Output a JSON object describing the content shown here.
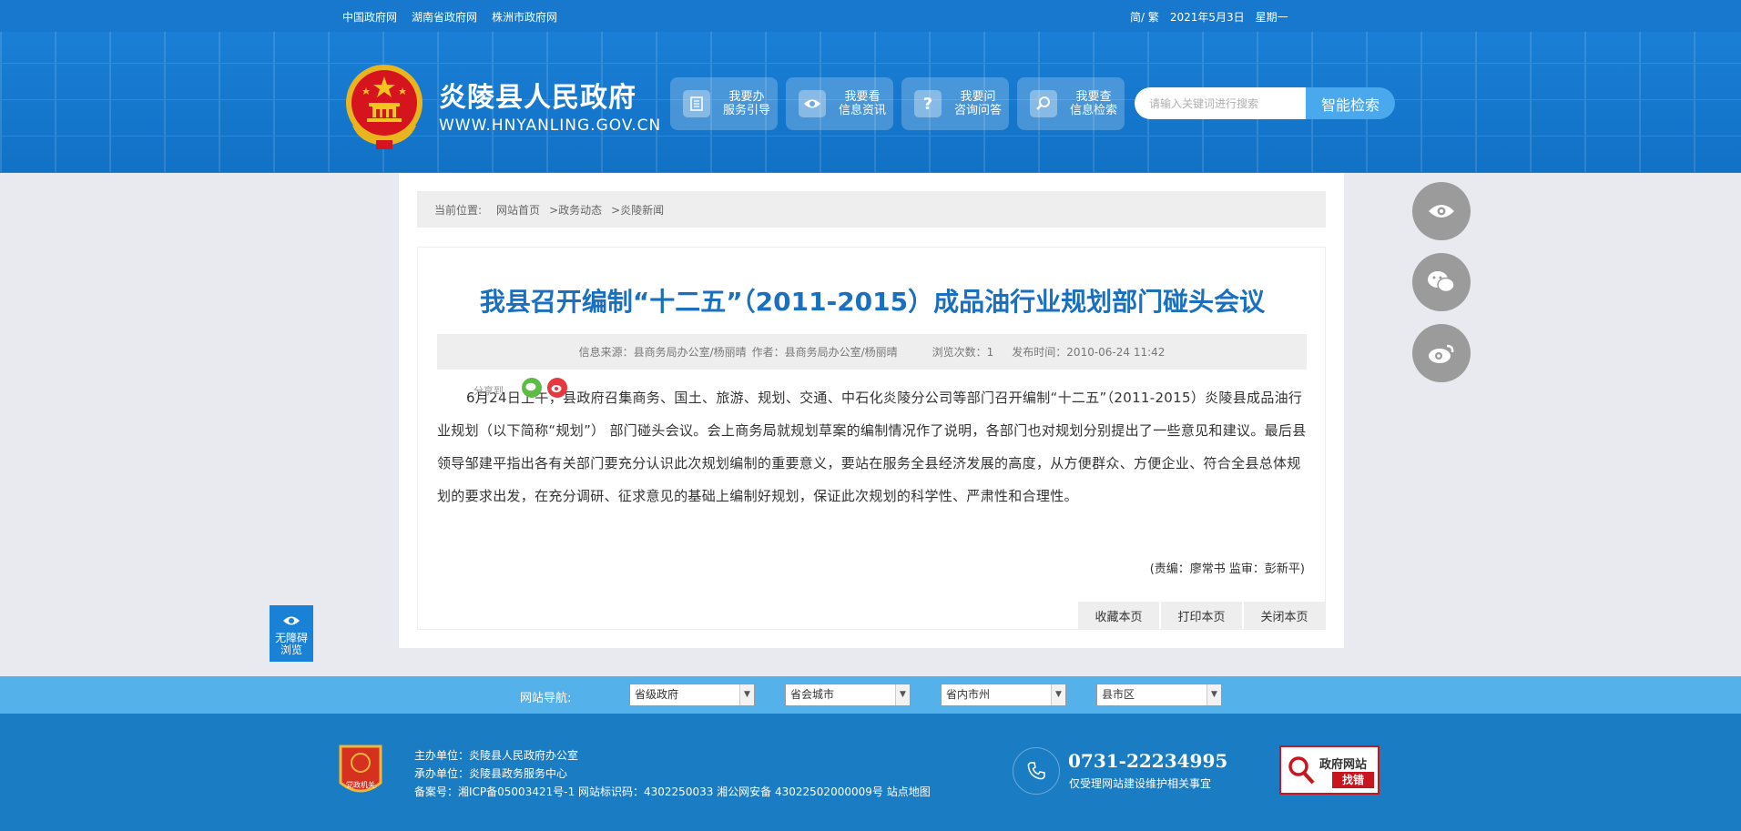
{
  "topbar": {
    "links": [
      "中国政府网",
      "湖南省政府网",
      "株洲市政府网"
    ],
    "lang": "简/ 繁",
    "date": "2021年5月3日",
    "weekday": "星期一"
  },
  "header": {
    "site_name": "炎陵县人民政府",
    "site_url": "WWW.HNYANLING.GOV.CN",
    "nav": [
      {
        "line1": "我要办",
        "line2": "服务引导",
        "icon": "document-icon"
      },
      {
        "line1": "我要看",
        "line2": "信息资讯",
        "icon": "eye-icon"
      },
      {
        "line1": "我要问",
        "line2": "咨询问答",
        "icon": "question-icon"
      },
      {
        "line1": "我要查",
        "line2": "信息检索",
        "icon": "search-icon"
      }
    ],
    "search_placeholder": "请输入关键词进行搜索",
    "search_button": "智能检索"
  },
  "breadcrumb": {
    "prefix": "当前位置:",
    "items": [
      "网站首页",
      ">政务动态",
      ">炎陵新闻"
    ]
  },
  "article": {
    "title": "我县召开编制“十二五”（2011-2015）成品油行业规划部门碰头会议",
    "source": "信息来源：县商务局办公室/杨丽晴",
    "author": "作者：县商务局办公室/杨丽晴",
    "views": "浏览次数：1",
    "published": "发布时间：2010-06-24 11:42",
    "share_label": "分享到",
    "body": "6月24日上午，县政府召集商务、国土、旅游、规划、交通、中石化炎陵分公司等部门召开编制“十二五”（2011-2015）炎陵县成品油行业规划（以下简称“规划”） 部门碰头会议。会上商务局就规划草案的编制情况作了说明，各部门也对规划分别提出了一些意见和建议。最后县领导邹建平指出各有关部门要充分认识此次规划编制的重要意义，要站在服务全县经济发展的高度，从方便群众、方便企业、符合全县总体规划的要求出发，在充分调研、征求意见的基础上编制好规划，保证此次规划的科学性、严肃性和合理性。",
    "editor": "(责编：廖常书   监审：彭新平)",
    "actions": [
      "收藏本页",
      "打印本页",
      "关闭本页"
    ]
  },
  "accessibility": {
    "line1": "无障碍",
    "line2": "浏览"
  },
  "sitenav": {
    "label": "网站导航:",
    "selects": [
      "省级政府",
      "省会城市",
      "省内市州",
      "县市区"
    ]
  },
  "footer": {
    "host": "主办单位：炎陵县人民政府办公室",
    "organizer": "承办单位：炎陵县政务服务中心",
    "record": "备案号：湘ICP备05003421号-1 网站标识码：4302250033 湘公网安备 43022502000009号 站点地图",
    "phone": "0731-22234995",
    "phone_note": "仅受理网站建设维护相关事宜",
    "badge_text": "党政机关",
    "error_line1": "政府网站",
    "error_line2": "找错"
  },
  "colors": {
    "topbar": "#1778cd",
    "header": "#1a7fd6",
    "title": "#1a6fbf",
    "navbar": "#55b1ea",
    "footer": "#1a7cc3",
    "error_red": "#c9151e"
  }
}
